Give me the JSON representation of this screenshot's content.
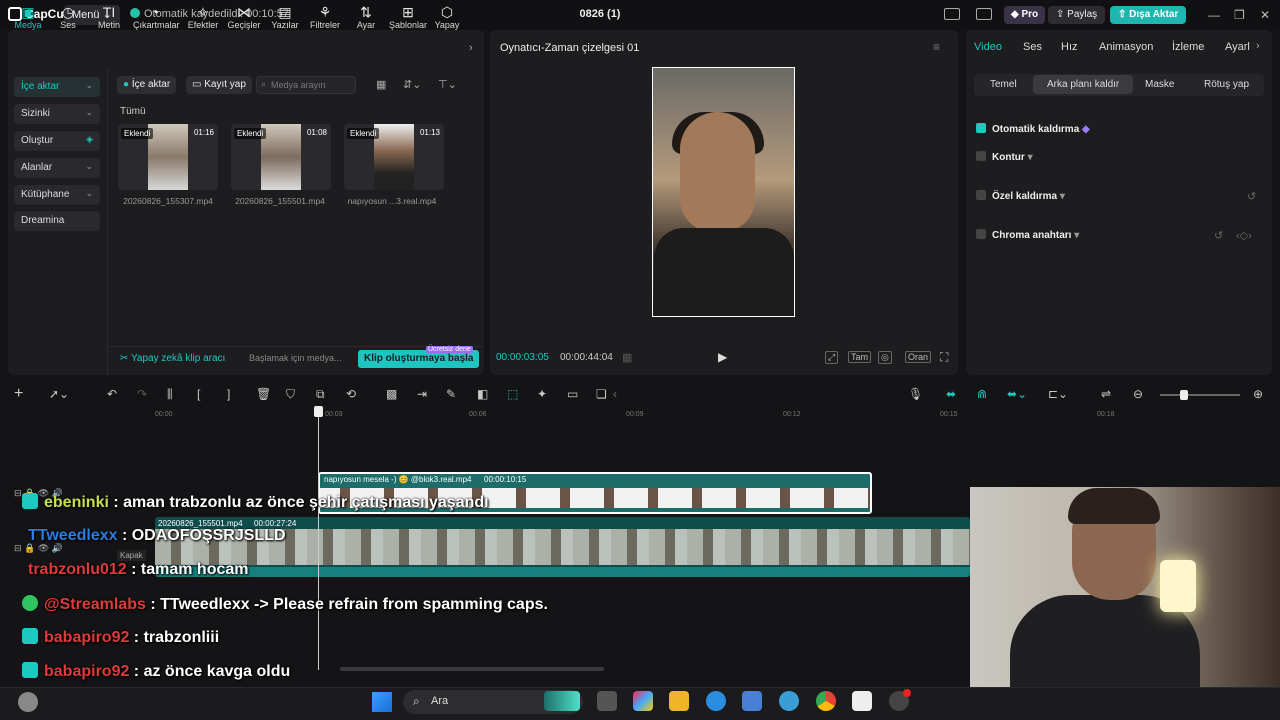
{
  "app": {
    "name": "CapCut",
    "menu_label": "Menü",
    "autosave": "Otomatik kaydedildi: 00:10:57",
    "project_title": "0826 (1)"
  },
  "titlebar": {
    "pro": "Pro",
    "share": "Paylaş",
    "export": "Dışa Aktar"
  },
  "tool_tabs": [
    {
      "label": "Medya",
      "icon": "media-icon"
    },
    {
      "label": "Ses",
      "icon": "audio-icon"
    },
    {
      "label": "Metin",
      "icon": "text-icon"
    },
    {
      "label": "Çıkartmalar",
      "icon": "sticker-icon"
    },
    {
      "label": "Efektler",
      "icon": "effects-icon"
    },
    {
      "label": "Geçişler",
      "icon": "transitions-icon"
    },
    {
      "label": "Yazılar",
      "icon": "captions-icon"
    },
    {
      "label": "Filtreler",
      "icon": "filters-icon"
    },
    {
      "label": "Ayar",
      "icon": "adjust-icon"
    },
    {
      "label": "Şablonlar",
      "icon": "templates-icon"
    },
    {
      "label": "Yapay",
      "icon": "ai-icon"
    }
  ],
  "sidebar": [
    {
      "label": "İçe aktar"
    },
    {
      "label": "Sizinki"
    },
    {
      "label": "Oluştur"
    },
    {
      "label": "Alanlar"
    },
    {
      "label": "Kütüphane"
    },
    {
      "label": "Dreamina"
    }
  ],
  "media": {
    "import": "İçe aktar",
    "record": "Kayıt yap",
    "search_placeholder": "Medya arayın",
    "all": "Tümü",
    "items": [
      {
        "badge": "Eklendi",
        "duration": "01:16",
        "name": "20260826_155307.mp4"
      },
      {
        "badge": "Eklendi",
        "duration": "01:08",
        "name": "20260826_155501.mp4"
      },
      {
        "badge": "Eklendi",
        "duration": "01:13",
        "name": "napıyosun ...3.real.mp4"
      }
    ],
    "ai_tool": "Yapay zekâ klip aracı",
    "ai_hint": "Başlamak için medya...",
    "clip_button": "Klip oluşturmaya başla",
    "free_badge": "Ücretsiz dene"
  },
  "player": {
    "title": "Oynatıcı-Zaman çizelgesi 01",
    "current": "00:00:03:05",
    "total": "00:00:44:04",
    "full": "Tam",
    "ratio": "Oran"
  },
  "right": {
    "tabs": [
      "Video",
      "Ses",
      "Hız",
      "Animasyon",
      "İzleme",
      "Ayarl"
    ],
    "subtabs": [
      "Temel",
      "Arka planı kaldır",
      "Maske",
      "Rötuş yap"
    ],
    "options": [
      {
        "label": "Otomatik kaldırma",
        "checked": true
      },
      {
        "label": "Kontur",
        "checked": false
      },
      {
        "label": "Özel kaldırma",
        "checked": false
      },
      {
        "label": "Chroma anahtarı",
        "checked": false
      }
    ]
  },
  "timeline": {
    "ticks": [
      "00:00",
      "00:03",
      "00:06",
      "00:09",
      "00:12",
      "00:15",
      "00:18"
    ],
    "clip_top": {
      "label": "napıyosun mesela -) 😊 @blok3.real.mp4",
      "duration": "00:00:10:15"
    },
    "clip_main": {
      "label": "20260826_155501.mp4",
      "duration": "00:00:27:24"
    },
    "cover": "Kapak"
  },
  "chat": [
    {
      "user": "ebeninki",
      "msg": " : aman trabzonlu az önce şehir çatışması yaşandı",
      "color": "#c5e04a"
    },
    {
      "user": "TTweedlexx",
      "msg": " : ODAOFOŞSRJSLLD",
      "color": "#2a7de1"
    },
    {
      "user": "trabzonlu012",
      "msg": " : tamam hocam",
      "color": "#e03a3a"
    },
    {
      "user": "@Streamlabs",
      "msg": " : TTweedlexx -> Please refrain from spamming caps.",
      "color": "#e03a3a"
    },
    {
      "user": "babapiro92",
      "msg": " : trabzonliii",
      "color": "#e03a3a"
    },
    {
      "user": "babapiro92",
      "msg": " : az önce kavga oldu",
      "color": "#e03a3a"
    }
  ],
  "taskbar": {
    "search": "Ara"
  },
  "colors": {
    "accent": "#1fc8c0",
    "background": "#141416",
    "panel": "#1d1d20"
  }
}
